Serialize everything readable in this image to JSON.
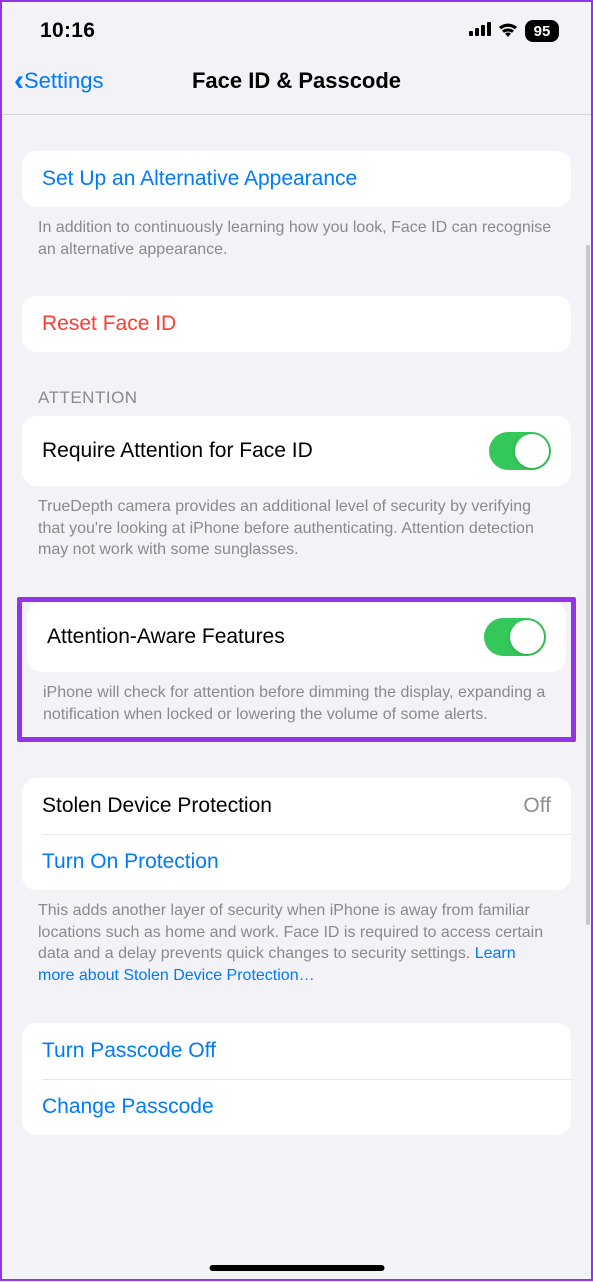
{
  "status": {
    "time": "10:16",
    "battery": "95"
  },
  "nav": {
    "back": "Settings",
    "title": "Face ID & Passcode"
  },
  "alt_appearance": {
    "label": "Set Up an Alternative Appearance",
    "footer": "In addition to continuously learning how you look, Face ID can recognise an alternative appearance."
  },
  "reset": {
    "label": "Reset Face ID"
  },
  "attention": {
    "header": "ATTENTION",
    "require": {
      "label": "Require Attention for Face ID",
      "footer": "TrueDepth camera provides an additional level of security by verifying that you're looking at iPhone before authenticating. Attention detection may not work with some sunglasses."
    },
    "aware": {
      "label": "Attention-Aware Features",
      "footer": "iPhone will check for attention before dimming the display, expanding a notification when locked or lowering the volume of some alerts."
    }
  },
  "stolen": {
    "label": "Stolen Device Protection",
    "value": "Off",
    "turn_on": "Turn On Protection",
    "footer": "This adds another layer of security when iPhone is away from familiar locations such as home and work. Face ID is required to access certain data and a delay prevents quick changes to security settings. ",
    "link": "Learn more about Stolen Device Protection…"
  },
  "passcode": {
    "off": "Turn Passcode Off",
    "change": "Change Passcode"
  }
}
